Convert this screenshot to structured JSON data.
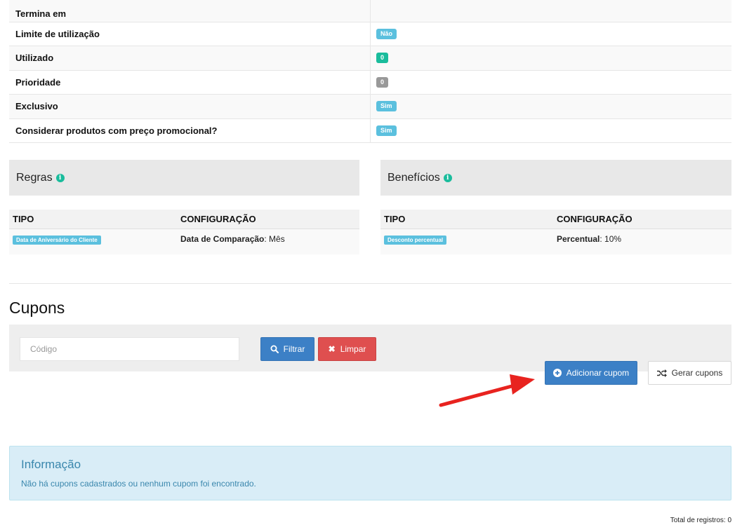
{
  "details": {
    "rows": [
      {
        "label": "Termina em",
        "badge": "",
        "badge_color": ""
      },
      {
        "label": "Limite de utilização",
        "badge": "Não",
        "badge_color": "#5bc0de"
      },
      {
        "label": "Utilizado",
        "badge": "0",
        "badge_color": "#1abc9c"
      },
      {
        "label": "Prioridade",
        "badge": "0",
        "badge_color": "#999999"
      },
      {
        "label": "Exclusivo",
        "badge": "Sim",
        "badge_color": "#5bc0de"
      },
      {
        "label": "Considerar produtos com preço promocional?",
        "badge": "Sim",
        "badge_color": "#5bc0de"
      }
    ]
  },
  "rules_panel": {
    "title": "Regras",
    "col_type": "TIPO",
    "col_config": "CONFIGURAÇÃO",
    "row_type": "Data de Aniversário do Cliente",
    "row_config_key": "Data de Comparação",
    "row_config_value": ": Mês"
  },
  "benefits_panel": {
    "title": "Benefícios",
    "col_type": "TIPO",
    "col_config": "CONFIGURAÇÃO",
    "row_type": "Desconto percentual",
    "row_config_key": "Percentual",
    "row_config_value": ": 10%"
  },
  "coupons": {
    "title": "Cupons",
    "code_placeholder": "Código",
    "filter_label": "Filtrar",
    "clear_label": "Limpar",
    "add_label": "Adicionar cupom",
    "generate_label": "Gerar cupons"
  },
  "alert": {
    "title": "Informação",
    "message": "Não há cupons cadastrados ou nenhum cupom foi encontrado."
  },
  "footer": {
    "total": "Total de registros: 0"
  },
  "colors": {
    "primary": "#3c80c6",
    "danger": "#df4f4f",
    "info_badge": "#5bc0de",
    "success_badge": "#1abc9c",
    "annotation_arrow": "#e8231f"
  }
}
